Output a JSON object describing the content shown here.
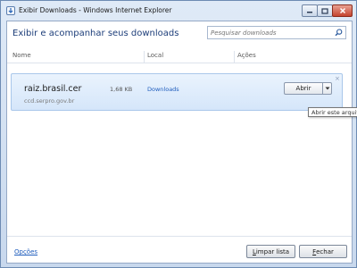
{
  "window": {
    "title": "Exibir Downloads - Windows Internet Explorer",
    "heading": "Exibir e acompanhar seus downloads"
  },
  "search": {
    "placeholder": "Pesquisar downloads"
  },
  "columns": {
    "name": "Nome",
    "location": "Local",
    "actions": "Ações"
  },
  "download": {
    "filename": "raiz.brasil.cer",
    "source": "ccd.serpro.gov.br",
    "size": "1,68 KB",
    "location": "Downloads",
    "open_label": "Abrir",
    "remove_glyph": "×"
  },
  "tooltip": "Abrir este arquivo",
  "footer": {
    "options_label": "Opções",
    "clear_label_first": "L",
    "clear_label_rest": "impar lista",
    "close_label_first": "F",
    "close_label_rest": "echar"
  },
  "icons": {
    "app": "ie-download-icon",
    "search": "search-icon",
    "dropdown": "chevron-down-icon"
  },
  "colors": {
    "accent": "#1f5dbd",
    "heading": "#1d3e7a",
    "row_highlight": "#d5e6fa"
  }
}
